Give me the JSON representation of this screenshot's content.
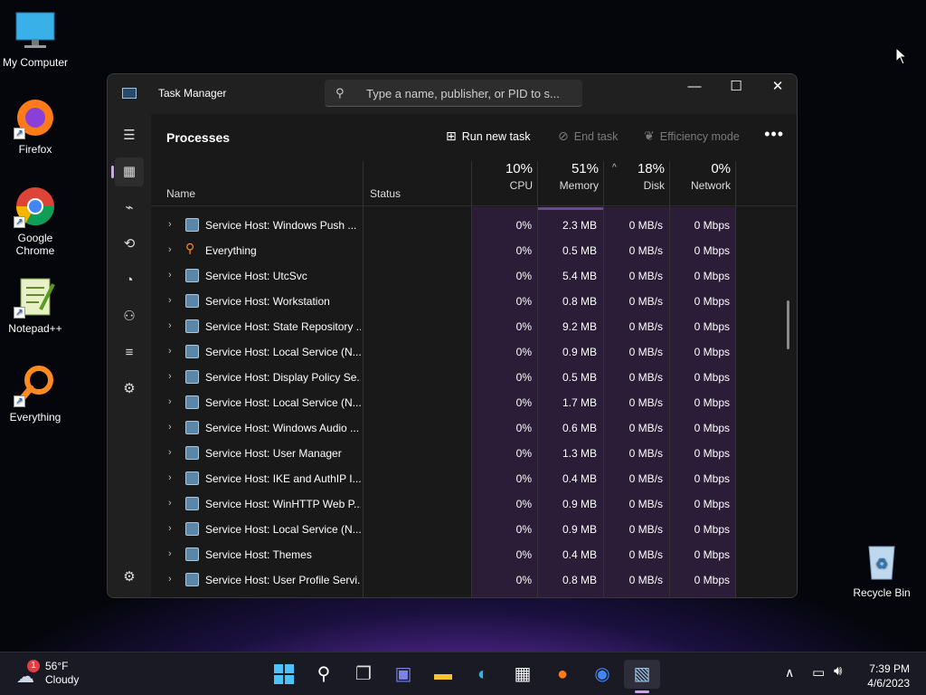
{
  "desktop": {
    "icons": [
      {
        "label": "My Computer"
      },
      {
        "label": "Firefox"
      },
      {
        "label": "Google Chrome"
      },
      {
        "label": "Notepad++"
      },
      {
        "label": "Everything"
      },
      {
        "label": "Recycle Bin"
      }
    ]
  },
  "window": {
    "title": "Task Manager",
    "search_placeholder": "Type a name, publisher, or PID to s...",
    "page_title": "Processes",
    "commands": {
      "run_new_task": "Run new task",
      "end_task": "End task",
      "efficiency_mode": "Efficiency mode"
    },
    "columns": {
      "name": "Name",
      "status": "Status",
      "cpu": {
        "pct": "10%",
        "label": "CPU"
      },
      "memory": {
        "pct": "51%",
        "label": "Memory"
      },
      "disk": {
        "pct": "18%",
        "label": "Disk"
      },
      "network": {
        "pct": "0%",
        "label": "Network"
      }
    },
    "rows": [
      {
        "name": "Service Host: Windows Push ...",
        "cpu": "0%",
        "memory": "2.3 MB",
        "disk": "0 MB/s",
        "network": "0 Mbps"
      },
      {
        "name": "Everything",
        "cpu": "0%",
        "memory": "0.5 MB",
        "disk": "0 MB/s",
        "network": "0 Mbps"
      },
      {
        "name": "Service Host: UtcSvc",
        "cpu": "0%",
        "memory": "5.4 MB",
        "disk": "0 MB/s",
        "network": "0 Mbps"
      },
      {
        "name": "Service Host: Workstation",
        "cpu": "0%",
        "memory": "0.8 MB",
        "disk": "0 MB/s",
        "network": "0 Mbps"
      },
      {
        "name": "Service Host: State Repository ...",
        "cpu": "0%",
        "memory": "9.2 MB",
        "disk": "0 MB/s",
        "network": "0 Mbps"
      },
      {
        "name": "Service Host: Local Service (N...",
        "cpu": "0%",
        "memory": "0.9 MB",
        "disk": "0 MB/s",
        "network": "0 Mbps"
      },
      {
        "name": "Service Host: Display Policy Se...",
        "cpu": "0%",
        "memory": "0.5 MB",
        "disk": "0 MB/s",
        "network": "0 Mbps"
      },
      {
        "name": "Service Host: Local Service (N...",
        "cpu": "0%",
        "memory": "1.7 MB",
        "disk": "0 MB/s",
        "network": "0 Mbps"
      },
      {
        "name": "Service Host: Windows Audio ...",
        "cpu": "0%",
        "memory": "0.6 MB",
        "disk": "0 MB/s",
        "network": "0 Mbps"
      },
      {
        "name": "Service Host: User Manager",
        "cpu": "0%",
        "memory": "1.3 MB",
        "disk": "0 MB/s",
        "network": "0 Mbps"
      },
      {
        "name": "Service Host: IKE and AuthIP I...",
        "cpu": "0%",
        "memory": "0.4 MB",
        "disk": "0 MB/s",
        "network": "0 Mbps"
      },
      {
        "name": "Service Host: WinHTTP Web P...",
        "cpu": "0%",
        "memory": "0.9 MB",
        "disk": "0 MB/s",
        "network": "0 Mbps"
      },
      {
        "name": "Service Host: Local Service (N...",
        "cpu": "0%",
        "memory": "0.9 MB",
        "disk": "0 MB/s",
        "network": "0 Mbps"
      },
      {
        "name": "Service Host: Themes",
        "cpu": "0%",
        "memory": "0.4 MB",
        "disk": "0 MB/s",
        "network": "0 Mbps"
      },
      {
        "name": "Service Host: User Profile Servi...",
        "cpu": "0%",
        "memory": "0.8 MB",
        "disk": "0 MB/s",
        "network": "0 Mbps"
      }
    ]
  },
  "taskbar": {
    "weather_temp": "56°F",
    "weather_desc": "Cloudy",
    "weather_badge": "1",
    "time": "7:39 PM",
    "date": "4/6/2023"
  },
  "colors": {
    "accent": "#c8a2ff",
    "heat": "#2b1d38"
  }
}
